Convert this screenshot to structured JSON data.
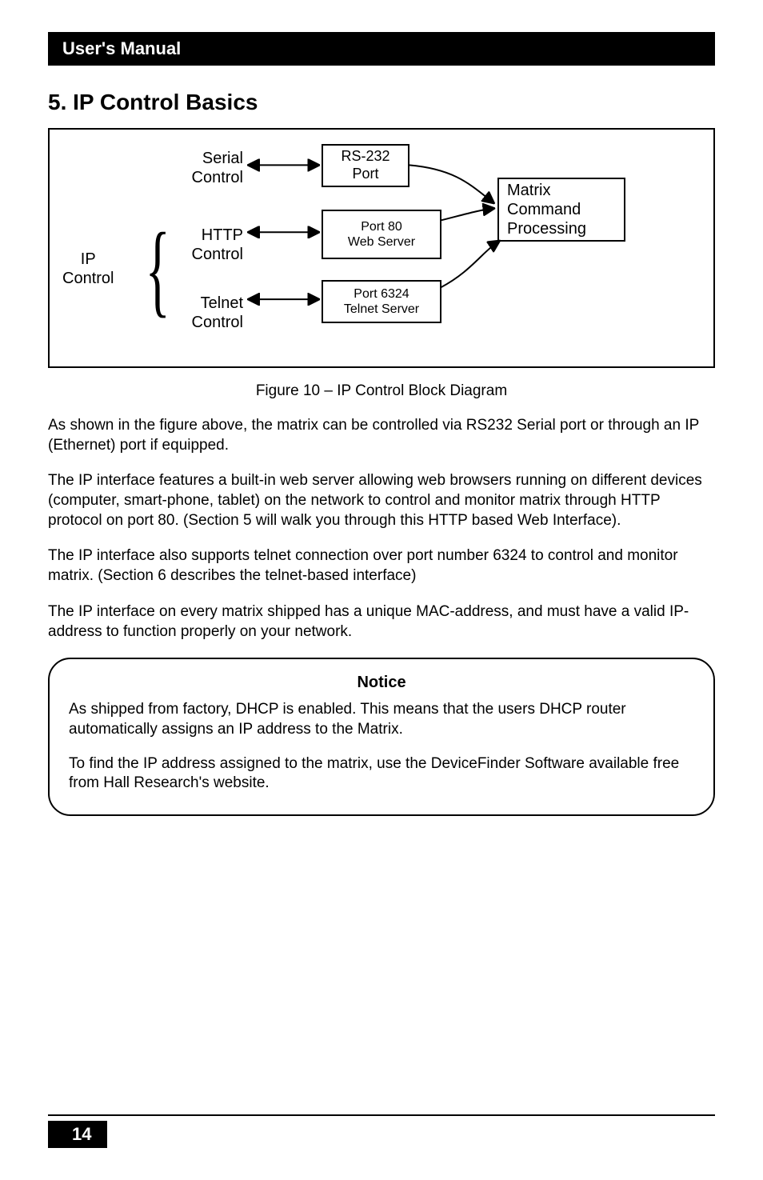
{
  "header": {
    "title": "User's Manual"
  },
  "section": {
    "heading": "5. IP Control Basics"
  },
  "diagram": {
    "ip_control": "IP\nControl",
    "serial": "Serial\nControl",
    "http": "HTTP\nControl",
    "telnet": "Telnet\nControl",
    "box_rs232": "RS-232\nPort",
    "box_port80": "Port 80\nWeb Server",
    "box_telnet": "Port 6324\nTelnet Server",
    "box_matrix": "Matrix\nCommand\nProcessing"
  },
  "caption": "Figure 10 – IP Control Block Diagram",
  "para1": "As shown in the figure above, the matrix can be controlled via RS232 Serial port or through an IP (Ethernet) port if equipped.",
  "para2": "The IP interface features a built-in web server  allowing web browsers running on different devices (computer, smart-phone, tablet)  on the network to control and monitor matrix through HTTP protocol on port 80. (Section 5 will walk you through this HTTP based Web Interface).",
  "para3": "The IP interface also supports telnet connection over port number 6324 to control and monitor matrix. (Section 6 describes the telnet-based interface)",
  "para4": "The IP interface on every matrix shipped has a unique MAC-address, and must have a valid IP-address to function properly on your network.",
  "notice": {
    "title": "Notice",
    "p1": "As shipped from factory, DHCP is enabled. This means that the users DHCP router automatically assigns an IP address to the Matrix.",
    "p2": "To find the IP address assigned to the matrix, use the DeviceFinder Software available free from Hall Research's website."
  },
  "page_number": "14",
  "chart_data": {
    "type": "diagram",
    "title": "IP Control Block Diagram",
    "nodes": [
      {
        "id": "serial",
        "label": "Serial Control"
      },
      {
        "id": "http",
        "label": "HTTP Control"
      },
      {
        "id": "telnet",
        "label": "Telnet Control"
      },
      {
        "id": "rs232",
        "label": "RS-232 Port"
      },
      {
        "id": "port80",
        "label": "Port 80 Web Server"
      },
      {
        "id": "port6324",
        "label": "Port 6324 Telnet Server"
      },
      {
        "id": "matrix",
        "label": "Matrix Command Processing"
      }
    ],
    "groups": [
      {
        "id": "ip_control",
        "label": "IP Control",
        "contains": [
          "http",
          "telnet"
        ]
      }
    ],
    "edges": [
      {
        "from": "serial",
        "to": "rs232",
        "direction": "both"
      },
      {
        "from": "http",
        "to": "port80",
        "direction": "both"
      },
      {
        "from": "telnet",
        "to": "port6324",
        "direction": "both"
      },
      {
        "from": "rs232",
        "to": "matrix",
        "direction": "to"
      },
      {
        "from": "port80",
        "to": "matrix",
        "direction": "to"
      },
      {
        "from": "port6324",
        "to": "matrix",
        "direction": "to"
      }
    ]
  }
}
